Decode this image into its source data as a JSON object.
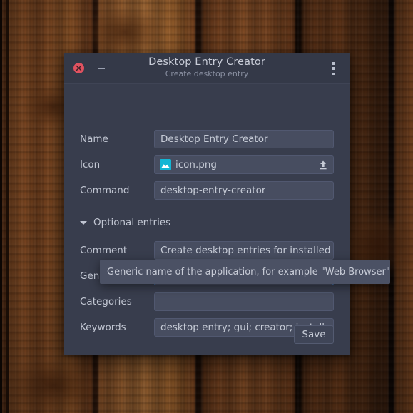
{
  "desktop": {
    "wallpaper_description": "wooden planks",
    "colors": {
      "wood_light": "#b2743c",
      "wood_mid": "#8a5128",
      "wood_dark": "#2e170b"
    }
  },
  "window": {
    "title": "Desktop Entry Creator",
    "subtitle": "Create desktop entry",
    "close_label": "Close",
    "minimize_label": "Minimize",
    "menu_label": "Menu",
    "colors": {
      "titlebar": "#343948",
      "body": "#383d4d",
      "field": "#474d60",
      "accent_focus": "#4a83c8",
      "close": "#e05260",
      "icon_accent": "#13b6d4"
    }
  },
  "form": {
    "fields": [
      {
        "label": "Name",
        "value": "Desktop Entry Creator",
        "placeholder": ""
      },
      {
        "label": "Icon",
        "value": "icon.png",
        "placeholder": ""
      },
      {
        "label": "Command",
        "value": "desktop-entry-creator",
        "placeholder": ""
      }
    ],
    "optional_section": {
      "label": "Optional entries",
      "expanded": true
    },
    "optional_fields": [
      {
        "label": "Comment",
        "value": "Create desktop entries for installed a",
        "placeholder": ""
      },
      {
        "label": "Generic name",
        "value": "",
        "placeholder": ""
      },
      {
        "label": "Categories",
        "value": "",
        "placeholder": ""
      },
      {
        "label": "Keywords",
        "value": "desktop entry; gui; creator; install",
        "placeholder": ""
      }
    ],
    "save_label": "Save"
  },
  "tooltip": {
    "text": "Generic name of the application, for example \"Web Browser\""
  }
}
